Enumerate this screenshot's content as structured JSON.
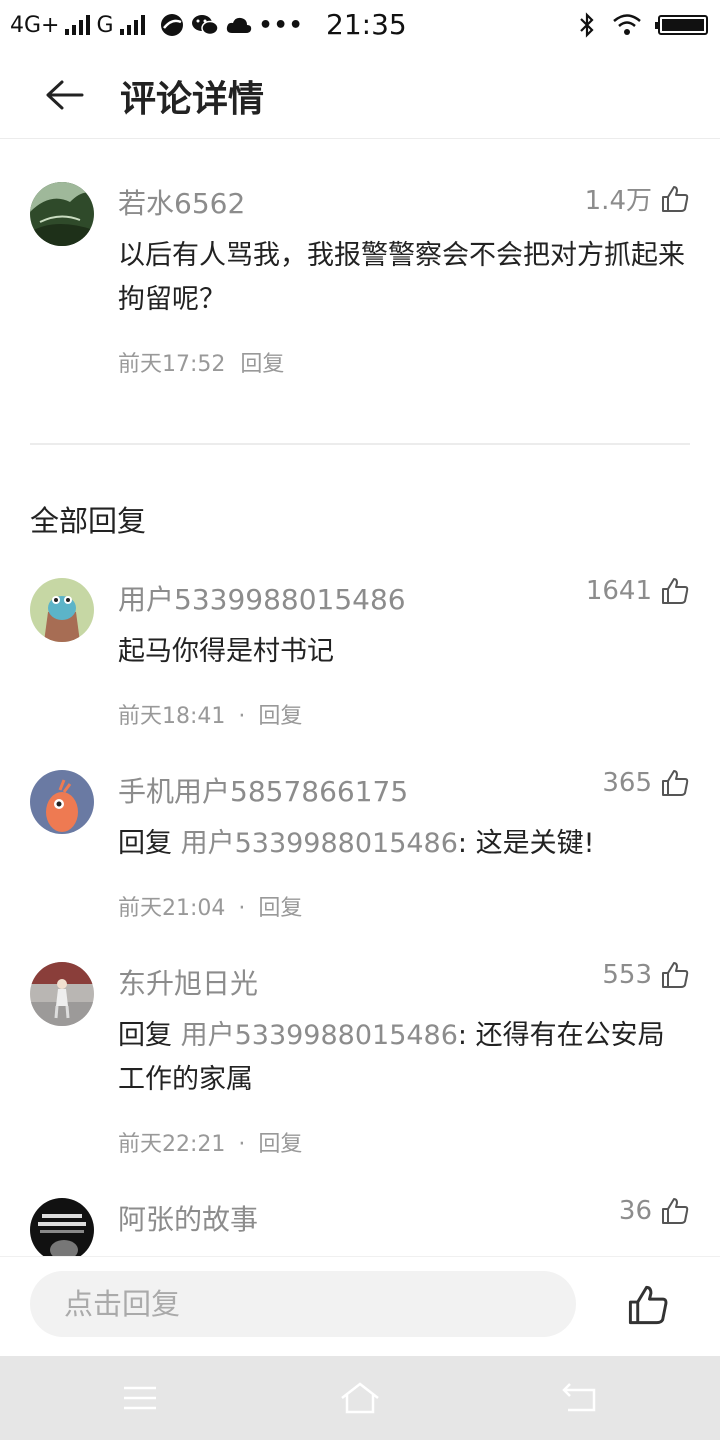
{
  "status_bar": {
    "network1": "4G+",
    "network2": "G",
    "time": "21:35"
  },
  "header": {
    "title": "评论详情",
    "back_icon": "arrow-left-icon"
  },
  "main_comment": {
    "username": "若水6562",
    "likes": "1.4万",
    "text": "以后有人骂我，我报警警察会不会把对方抓起来拘留呢？",
    "time": "前天17:52",
    "reply_label": "回复"
  },
  "replies_section": {
    "title": "全部回复"
  },
  "replies": [
    {
      "username": "用户5339988015486",
      "likes": "1641",
      "text": "起马你得是村书记",
      "time": "前天18:41",
      "separator": "·",
      "reply_label": "回复"
    },
    {
      "username": "手机用户5857866175",
      "likes": "365",
      "reply_word": "回复",
      "reply_target": "用户5339988015486",
      "text": ": 这是关键!",
      "time": "前天21:04",
      "separator": "·",
      "reply_label": "回复"
    },
    {
      "username": "东升旭日光",
      "likes": "553",
      "reply_word": "回复",
      "reply_target": "用户5339988015486",
      "text": ": 还得有在公安局工作的家属",
      "time": "前天22:21",
      "separator": "·",
      "reply_label": "回复"
    },
    {
      "username": "阿张的故事",
      "likes": "36"
    }
  ],
  "reply_bar": {
    "placeholder": "点击回复"
  },
  "colors": {
    "text_primary": "#222222",
    "text_secondary": "#8c8c8c",
    "input_bg": "#f2f2f2",
    "nav_bg": "#e6e6e6"
  }
}
